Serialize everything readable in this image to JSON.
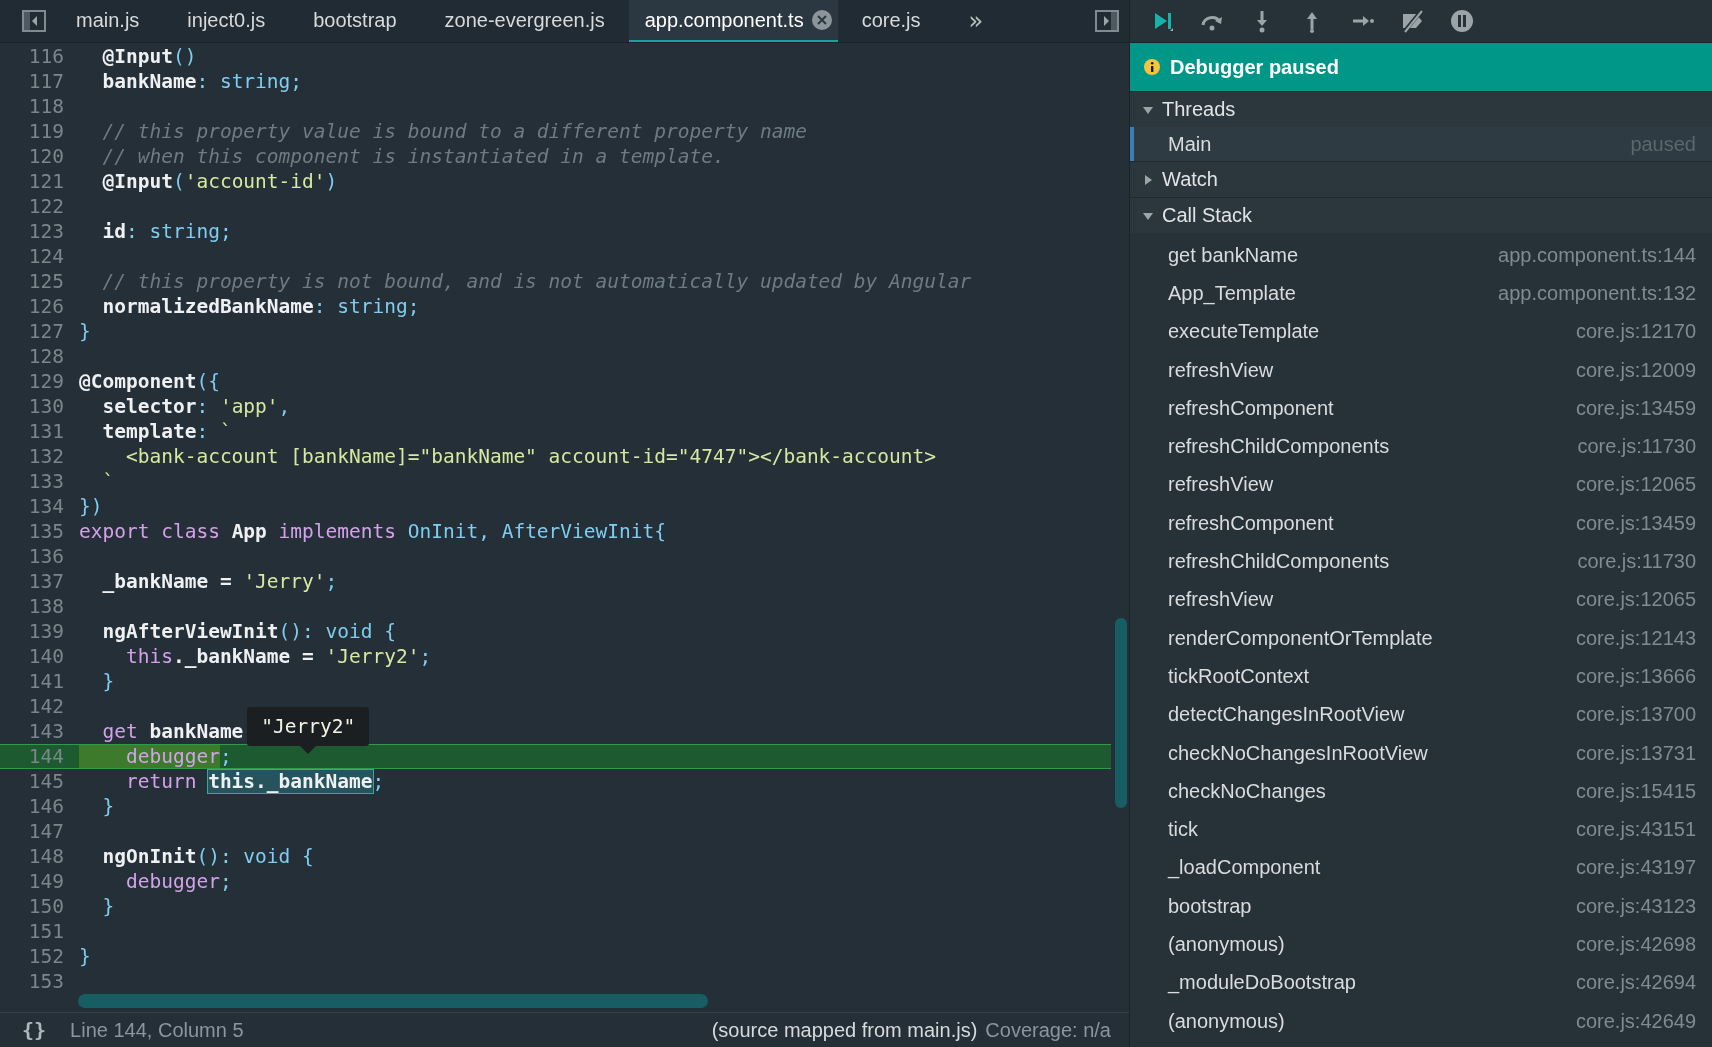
{
  "editor_tabs": {
    "tabs": [
      {
        "label": "main.js",
        "selected": false,
        "closable": false
      },
      {
        "label": "inject0.js",
        "selected": false,
        "closable": false
      },
      {
        "label": "bootstrap",
        "selected": false,
        "closable": false
      },
      {
        "label": "zone-evergreen.js",
        "selected": false,
        "closable": false
      },
      {
        "label": "app.component.ts",
        "selected": true,
        "closable": true
      },
      {
        "label": "core.js",
        "selected": false,
        "closable": false
      }
    ],
    "overflow": "»"
  },
  "code": {
    "lines": [
      {
        "number": "116",
        "current": false,
        "tokens": [
          {
            "t": "  @Input",
            "kind": "plain"
          },
          {
            "t": "()",
            "kind": "type"
          }
        ]
      },
      {
        "number": "117",
        "current": false,
        "tokens": [
          {
            "t": "  bankName",
            "kind": "plain"
          },
          {
            "t": ": string;",
            "kind": "type"
          }
        ]
      },
      {
        "number": "118",
        "current": false
      },
      {
        "number": "119",
        "current": false,
        "tokens": [
          {
            "t": "  // this property value is bound to a different property name",
            "kind": "comment"
          }
        ]
      },
      {
        "number": "120",
        "current": false,
        "tokens": [
          {
            "t": "  // when this component is instantiated in a template.",
            "kind": "comment"
          }
        ]
      },
      {
        "number": "121",
        "current": false,
        "tokens": [
          {
            "t": "  @Input",
            "kind": "plain"
          },
          {
            "t": "(",
            "kind": "type"
          },
          {
            "t": "'account-id'",
            "kind": "string"
          },
          {
            "t": ")",
            "kind": "type"
          }
        ]
      },
      {
        "number": "122",
        "current": false
      },
      {
        "number": "123",
        "current": false,
        "tokens": [
          {
            "t": "  id",
            "kind": "plain"
          },
          {
            "t": ": string;",
            "kind": "type"
          }
        ]
      },
      {
        "number": "124",
        "current": false
      },
      {
        "number": "125",
        "current": false,
        "tokens": [
          {
            "t": "  // this property is not bound, and is not automatically updated by Angular",
            "kind": "comment"
          }
        ]
      },
      {
        "number": "126",
        "current": false,
        "tokens": [
          {
            "t": "  normalizedBankName",
            "kind": "plain"
          },
          {
            "t": ": string;",
            "kind": "type"
          }
        ]
      },
      {
        "number": "127",
        "current": false,
        "tokens": [
          {
            "t": "}",
            "kind": "type"
          }
        ]
      },
      {
        "number": "128",
        "current": false
      },
      {
        "number": "129",
        "current": false,
        "tokens": [
          {
            "t": "@Component",
            "kind": "plain"
          },
          {
            "t": "({",
            "kind": "type"
          }
        ]
      },
      {
        "number": "130",
        "current": false,
        "tokens": [
          {
            "t": "  selector",
            "kind": "plain"
          },
          {
            "t": ": ",
            "kind": "type"
          },
          {
            "t": "'app'",
            "kind": "string"
          },
          {
            "t": ",",
            "kind": "type"
          }
        ]
      },
      {
        "number": "131",
        "current": false,
        "tokens": [
          {
            "t": "  template",
            "kind": "plain"
          },
          {
            "t": ": ",
            "kind": "type"
          },
          {
            "t": "`",
            "kind": "string"
          }
        ]
      },
      {
        "number": "132",
        "current": false,
        "tokens": [
          {
            "t": "    <bank-account [bankName]=\"bankName\" account-id=\"4747\"></bank-account>",
            "kind": "string"
          }
        ]
      },
      {
        "number": "133",
        "current": false,
        "tokens": [
          {
            "t": "  `",
            "kind": "string"
          }
        ]
      },
      {
        "number": "134",
        "current": false,
        "tokens": [
          {
            "t": "})",
            "kind": "type"
          }
        ]
      },
      {
        "number": "135",
        "current": false,
        "tokens": [
          {
            "t": "export class ",
            "kind": "keyword"
          },
          {
            "t": "App ",
            "kind": "plain"
          },
          {
            "t": "implements ",
            "kind": "keyword"
          },
          {
            "t": "OnInit, AfterViewInit{",
            "kind": "type"
          }
        ]
      },
      {
        "number": "136",
        "current": false
      },
      {
        "number": "137",
        "current": false,
        "tokens": [
          {
            "t": "  _bankName = ",
            "kind": "plain"
          },
          {
            "t": "'Jerry'",
            "kind": "string"
          },
          {
            "t": ";",
            "kind": "type"
          }
        ]
      },
      {
        "number": "138",
        "current": false
      },
      {
        "number": "139",
        "current": false,
        "tokens": [
          {
            "t": "  ngAfterViewInit",
            "kind": "plain"
          },
          {
            "t": "(): void {",
            "kind": "type"
          }
        ]
      },
      {
        "number": "140",
        "current": false,
        "tokens": [
          {
            "t": "    this",
            "kind": "keyword"
          },
          {
            "t": "._bankName = ",
            "kind": "plain"
          },
          {
            "t": "'Jerry2'",
            "kind": "string"
          },
          {
            "t": ";",
            "kind": "type"
          }
        ]
      },
      {
        "number": "141",
        "current": false,
        "tokens": [
          {
            "t": "  }",
            "kind": "type"
          }
        ]
      },
      {
        "number": "142",
        "current": false
      },
      {
        "number": "143",
        "current": false,
        "tokens": [
          {
            "t": "  get",
            "kind": "keyword"
          },
          {
            "t": " bankName",
            "kind": "plain"
          }
        ],
        "tooltip": "\"Jerry2\""
      },
      {
        "number": "144",
        "current": true,
        "tokens": [
          {
            "t": "    debugger",
            "kind": "keyword",
            "breakpoint": true
          },
          {
            "t": ";",
            "kind": "type"
          }
        ]
      },
      {
        "number": "145",
        "current": false,
        "tokens": [
          {
            "t": "    return ",
            "kind": "keyword"
          },
          {
            "t": "this._bankName",
            "kind": "plain",
            "selection": true
          },
          {
            "t": ";",
            "kind": "type"
          }
        ]
      },
      {
        "number": "146",
        "current": false,
        "tokens": [
          {
            "t": "  }",
            "kind": "type"
          }
        ]
      },
      {
        "number": "147",
        "current": false
      },
      {
        "number": "148",
        "current": false,
        "tokens": [
          {
            "t": "  ngOnInit",
            "kind": "plain"
          },
          {
            "t": "(): void {",
            "kind": "type"
          }
        ]
      },
      {
        "number": "149",
        "current": false,
        "tokens": [
          {
            "t": "    debugger",
            "kind": "keyword"
          },
          {
            "t": ";",
            "kind": "type"
          }
        ]
      },
      {
        "number": "150",
        "current": false,
        "tokens": [
          {
            "t": "  }",
            "kind": "type"
          }
        ]
      },
      {
        "number": "151",
        "current": false
      },
      {
        "number": "152",
        "current": false,
        "tokens": [
          {
            "t": "}",
            "kind": "type"
          }
        ]
      },
      {
        "number": "153",
        "current": false
      }
    ]
  },
  "status_bar": {
    "format_button": "{}",
    "position": "Line 144, Column 5",
    "source": "(source mapped from main.js)",
    "coverage": "Coverage: n/a"
  },
  "debugger": {
    "banner": "Debugger paused",
    "sections": [
      {
        "title": "Threads",
        "expanded": true,
        "threads": [
          {
            "name": "Main",
            "state": "paused",
            "selected": true
          }
        ]
      },
      {
        "title": "Watch",
        "expanded": false
      },
      {
        "title": "Call Stack",
        "expanded": true,
        "frames": [
          {
            "name": "get bankName",
            "location": "app.component.ts:144"
          },
          {
            "name": "App_Template",
            "location": "app.component.ts:132"
          },
          {
            "name": "executeTemplate",
            "location": "core.js:12170"
          },
          {
            "name": "refreshView",
            "location": "core.js:12009"
          },
          {
            "name": "refreshComponent",
            "location": "core.js:13459"
          },
          {
            "name": "refreshChildComponents",
            "location": "core.js:11730"
          },
          {
            "name": "refreshView",
            "location": "core.js:12065"
          },
          {
            "name": "refreshComponent",
            "location": "core.js:13459"
          },
          {
            "name": "refreshChildComponents",
            "location": "core.js:11730"
          },
          {
            "name": "refreshView",
            "location": "core.js:12065"
          },
          {
            "name": "renderComponentOrTemplate",
            "location": "core.js:12143"
          },
          {
            "name": "tickRootContext",
            "location": "core.js:13666"
          },
          {
            "name": "detectChangesInRootView",
            "location": "core.js:13700"
          },
          {
            "name": "checkNoChangesInRootView",
            "location": "core.js:13731"
          },
          {
            "name": "checkNoChanges",
            "location": "core.js:15415"
          },
          {
            "name": "tick",
            "location": "core.js:43151"
          },
          {
            "name": "_loadComponent",
            "location": "core.js:43197"
          },
          {
            "name": "bootstrap",
            "location": "core.js:43123"
          },
          {
            "name": "(anonymous)",
            "location": "core.js:42698"
          },
          {
            "name": "_moduleDoBootstrap",
            "location": "core.js:42694"
          },
          {
            "name": "(anonymous)",
            "location": "core.js:42649"
          }
        ]
      }
    ]
  }
}
